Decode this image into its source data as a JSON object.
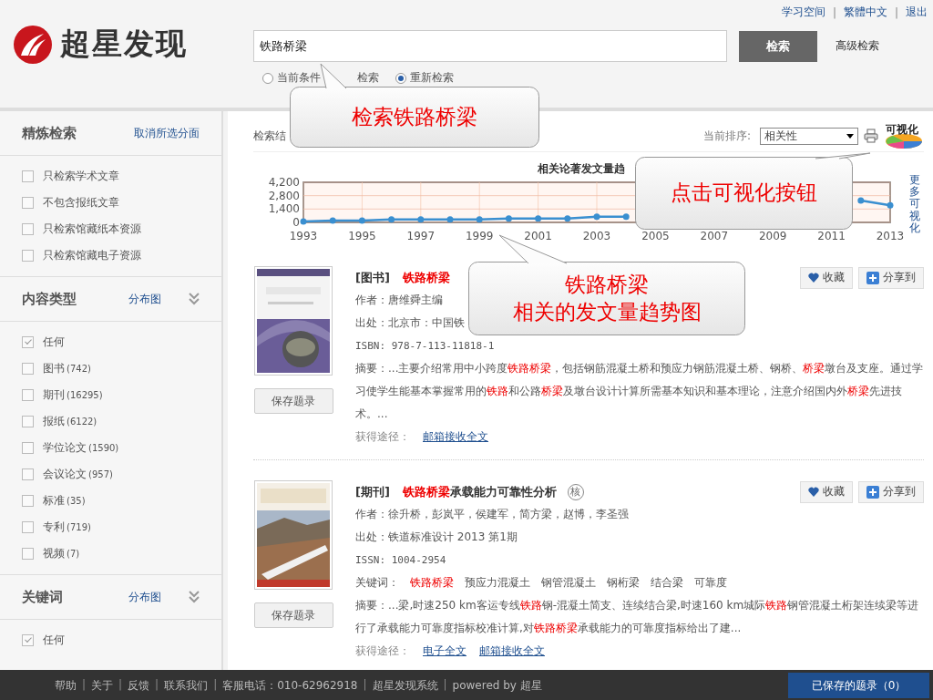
{
  "header": {
    "logo_text": "超星发现",
    "top_links": [
      {
        "kind": "link",
        "text": "学习空间"
      },
      {
        "kind": "separator",
        "text": "|"
      },
      {
        "kind": "link",
        "text": "繁體中文"
      },
      {
        "kind": "separator",
        "text": "|"
      },
      {
        "kind": "link",
        "text": "退出"
      }
    ],
    "search": {
      "value": "铁路桥梁",
      "button": "检索",
      "advanced": "高级检索"
    },
    "scope": [
      {
        "label": "当前条件",
        "trailing": "检索",
        "selected": false
      },
      {
        "label": "重新检索",
        "selected": true
      }
    ]
  },
  "sidebar": [
    {
      "title": "精炼检索",
      "link": "取消所选分面",
      "collapsible": false,
      "items": [
        {
          "label": "只检索学术文章",
          "checked": false
        },
        {
          "label": "不包含报纸文章",
          "checked": false
        },
        {
          "label": "只检索馆藏纸本资源",
          "checked": false
        },
        {
          "label": "只检索馆藏电子资源",
          "checked": false
        }
      ]
    },
    {
      "title": "内容类型",
      "link": "分布图",
      "collapsible": true,
      "items": [
        {
          "label": "任何",
          "checked": true
        },
        {
          "label": "图书",
          "count": "(742)",
          "checked": false
        },
        {
          "label": "期刊",
          "count": "(16295)",
          "checked": false
        },
        {
          "label": "报纸",
          "count": "(6122)",
          "checked": false
        },
        {
          "label": "学位论文",
          "count": "(1590)",
          "checked": false
        },
        {
          "label": "会议论文",
          "count": "(957)",
          "checked": false
        },
        {
          "label": "标准",
          "count": "(35)",
          "checked": false
        },
        {
          "label": "专利",
          "count": "(719)",
          "checked": false
        },
        {
          "label": "视频",
          "count": "(7)",
          "checked": false
        }
      ]
    },
    {
      "title": "关键词",
      "link": "分布图",
      "collapsible": true,
      "items": [
        {
          "label": "任何",
          "checked": true
        }
      ]
    }
  ],
  "toolbar": {
    "result_label": "检索结",
    "sort_label": "当前排序:",
    "sort_value": "相关性",
    "visualize": "可视化"
  },
  "chart": {
    "more_link": "更多可视化",
    "chart_data": {
      "type": "line",
      "title": "相关论著发文量趋",
      "x": [
        1993,
        1994,
        1995,
        1996,
        1997,
        1998,
        1999,
        2000,
        2001,
        2002,
        2003,
        2004,
        2012,
        2013
      ],
      "series": [
        {
          "color": "#3a8fd0",
          "marker": "circle",
          "values": [
            100,
            200,
            200,
            300,
            300,
            300,
            300,
            400,
            400,
            400,
            600,
            600,
            2300,
            1800
          ]
        }
      ],
      "xlim": [
        1993,
        2013
      ],
      "xticks": [
        1993,
        1995,
        1997,
        1999,
        2001,
        2003,
        2005,
        2007,
        2009,
        2011,
        2013
      ],
      "yticks": [
        {
          "value": 0,
          "label": "0"
        },
        {
          "value": 1400,
          "label": "1,400"
        },
        {
          "value": 2800,
          "label": "2,800"
        },
        {
          "value": 4200,
          "label": "4,200"
        }
      ],
      "ylim": [
        0,
        4200
      ],
      "grid": true
    }
  },
  "results": [
    {
      "cover": {
        "kind": "picture"
      },
      "type": "[图书]",
      "title": "**铁路桥梁**",
      "save": "保存题录",
      "collect": "收藏",
      "share": "分享到",
      "lines": [
        {
          "kind": "text",
          "text": "作者：唐维舜主编"
        },
        {
          "kind": "text",
          "text": "出处：北京市：中国铁"
        },
        {
          "kind": "mono",
          "text": "ISBN: 978-7-113-11818-1"
        },
        {
          "kind": "text",
          "text": "摘要：...主要介绍常用中小跨度**铁路桥梁**，包括钢筋混凝土桥和预应力钢筋混凝土桥、钢桥、**桥梁**墩台及支座。通过学习使学生能基本掌握常用的**铁路**和公路**桥梁**及墩台设计计算所需基本知识和基本理论，注意介绍国内外**桥梁**先进技术。..."
        }
      ],
      "access_label": "获得途径：",
      "access_links": [
        "邮箱接收全文"
      ]
    },
    {
      "cover": {
        "kind": "picture"
      },
      "type": "[期刊]",
      "title": "**铁路桥梁**承载能力可靠性分析",
      "badge": "核",
      "save": "保存题录",
      "collect": "收藏",
      "share": "分享到",
      "lines": [
        {
          "kind": "text",
          "text": "作者：徐升桥，彭岚平，侯建军，简方梁，赵博，李圣强"
        },
        {
          "kind": "text",
          "text": "出处：铁道标准设计 2013 第1期"
        },
        {
          "kind": "mono",
          "text": "ISSN: 1004-2954"
        },
        {
          "kind": "keywords",
          "label": "关键词：",
          "keywords": [
            {
              "text": "铁路桥梁",
              "highlighted": true
            },
            {
              "text": "预应力混凝土",
              "highlighted": false
            },
            {
              "text": "钢管混凝土",
              "highlighted": false
            },
            {
              "text": "钢桁梁",
              "highlighted": false
            },
            {
              "text": "结合梁",
              "highlighted": false
            },
            {
              "text": "可靠度",
              "highlighted": false
            }
          ]
        },
        {
          "kind": "text",
          "text": "摘要：...梁,时速250 km客运专线**铁路**钢-混凝土简支、连续结合梁,时速160 km城际**铁路**钢管混凝土桁架连续梁等进行了承载能力可靠度指标校准计算,对**铁路桥梁**承载能力的可靠度指标给出了建..."
        }
      ],
      "access_label": "获得途径：",
      "access_links": [
        "电子全文",
        "邮箱接收全文"
      ]
    }
  ],
  "footer": {
    "links": [
      {
        "kind": "link",
        "text": "帮助"
      },
      {
        "kind": "separator",
        "text": "|"
      },
      {
        "kind": "link",
        "text": "关于"
      },
      {
        "kind": "separator",
        "text": "|"
      },
      {
        "kind": "link",
        "text": "反馈"
      },
      {
        "kind": "separator",
        "text": "|"
      },
      {
        "kind": "link",
        "text": "联系我们"
      },
      {
        "kind": "separator",
        "text": "|"
      },
      {
        "kind": "link",
        "text": "客服电话：010-62962918"
      },
      {
        "kind": "separator",
        "text": "|"
      },
      {
        "kind": "link",
        "text": "超星发现系统"
      },
      {
        "kind": "separator",
        "text": "|"
      },
      {
        "kind": "link",
        "text": "powered by 超星"
      }
    ],
    "saved_button": "已保存的题录（0）"
  },
  "callouts": [
    {
      "lines": [
        "检索铁路桥梁"
      ]
    },
    {
      "lines": [
        "点击可视化按钮"
      ]
    },
    {
      "lines": [
        "铁路桥梁",
        "相关的发文量趋势图"
      ]
    }
  ]
}
